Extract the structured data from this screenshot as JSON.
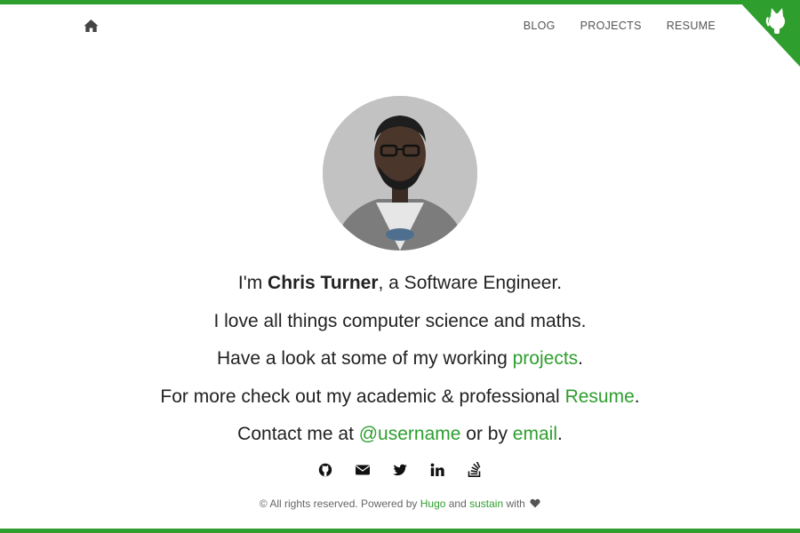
{
  "nav": {
    "home_icon": "home-icon",
    "links": [
      {
        "label": "BLOG"
      },
      {
        "label": "PROJECTS"
      },
      {
        "label": "RESUME"
      }
    ],
    "corner_icon": "github-corner-icon"
  },
  "colors": {
    "accent": "#2e9e2e",
    "text": "#222222",
    "muted": "#666666"
  },
  "intro": {
    "line1_prefix": "I'm ",
    "name": "Chris Turner",
    "line1_suffix": ", a Software Engineer.",
    "line2": "I love all things computer science and maths.",
    "line3_prefix": "Have a look at some of my working ",
    "line3_link": "projects",
    "line3_suffix": ".",
    "line4_prefix": "For more check out my academic & professional ",
    "line4_link": "Resume",
    "line4_suffix": ".",
    "line5_prefix": "Contact me at ",
    "line5_link1": "@username",
    "line5_middle": " or by ",
    "line5_link2": "email",
    "line5_suffix": "."
  },
  "socials": [
    {
      "icon": "github-icon"
    },
    {
      "icon": "email-icon"
    },
    {
      "icon": "twitter-icon"
    },
    {
      "icon": "linkedin-icon"
    },
    {
      "icon": "stackoverflow-icon"
    }
  ],
  "footer": {
    "prefix": "© All rights reserved. Powered by ",
    "link1": "Hugo",
    "middle": " and ",
    "link2": "sustain",
    "suffix": " with ",
    "heart_icon": "heart-icon"
  }
}
